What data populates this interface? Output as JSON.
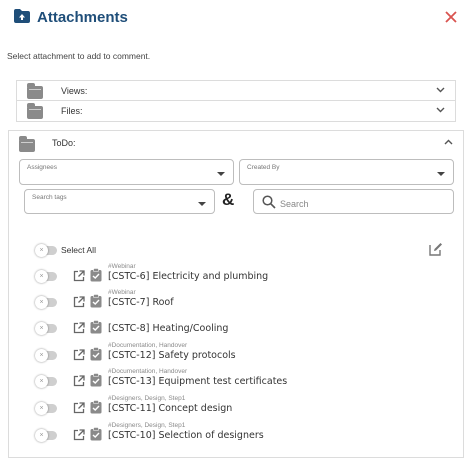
{
  "header": {
    "title": "Attachments",
    "folder_icon": "folder-upload-icon",
    "close_icon": "close-icon",
    "close_color": "#d9534f",
    "title_color": "#1f4e79"
  },
  "subtitle": "Select attachment to add to comment.",
  "sections": {
    "views": {
      "label": "Views:"
    },
    "files": {
      "label": "Files:"
    },
    "todo": {
      "label": "ToDo:"
    }
  },
  "filters": {
    "assignees_label": "Assignees",
    "created_by_label": "Created By",
    "search_tags_label": "Search tags",
    "ampersand": "&",
    "search_placeholder": "Search"
  },
  "list": {
    "select_all_label": "Select All",
    "items": [
      {
        "tag": "#Webinar",
        "title": "[CSTC-6] Electricity and plumbing"
      },
      {
        "tag": "#Webinar",
        "title": "[CSTC-7] Roof"
      },
      {
        "tag": "",
        "title": "[CSTC-8] Heating/Cooling"
      },
      {
        "tag": "#Documentation, Handover",
        "title": "[CSTC-12] Safety protocols"
      },
      {
        "tag": "#Documentation, Handover",
        "title": "[CSTC-13] Equipment test certificates"
      },
      {
        "tag": "#Designers, Design, Step1",
        "title": "[CSTC-11] Concept design"
      },
      {
        "tag": "#Designers, Design, Step1",
        "title": "[CSTC-10] Selection of designers"
      }
    ]
  }
}
